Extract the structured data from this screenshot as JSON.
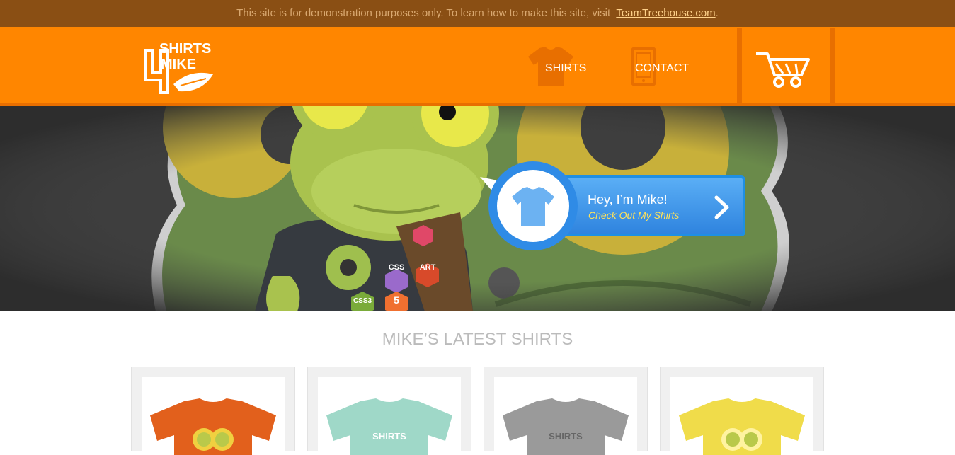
{
  "demo_banner": {
    "text": "This site is for demonstration purposes only. To learn how to make this site, visit",
    "link_text": "TeamTreehouse.com",
    "trailing": "."
  },
  "header": {
    "logo_alt": "Shirts 4 Mike",
    "nav": [
      {
        "label": "SHIRTS",
        "icon": "tshirt-icon"
      },
      {
        "label": "CONTACT",
        "icon": "phone-icon"
      }
    ],
    "cart_icon": "cart-icon"
  },
  "hero": {
    "cta_title": "Hey, I’m Mike!",
    "cta_subtitle": "Check Out My Shirts",
    "badge_labels": [
      "CSS",
      "ART",
      "CSS3",
      "5"
    ]
  },
  "latest": {
    "title": "MIKE’S LATEST SHIRTS",
    "shirts": [
      {
        "color": "#e2601c",
        "label": ""
      },
      {
        "color": "#9fd8c8",
        "label": "SHIRTS"
      },
      {
        "color": "#9a9a9a",
        "label": "SHIRTS"
      },
      {
        "color": "#f0dc4a",
        "label": ""
      }
    ]
  },
  "colors": {
    "brand_orange": "#ff8600",
    "banner_brown": "#8a4f14",
    "cta_blue": "#2f84df"
  }
}
